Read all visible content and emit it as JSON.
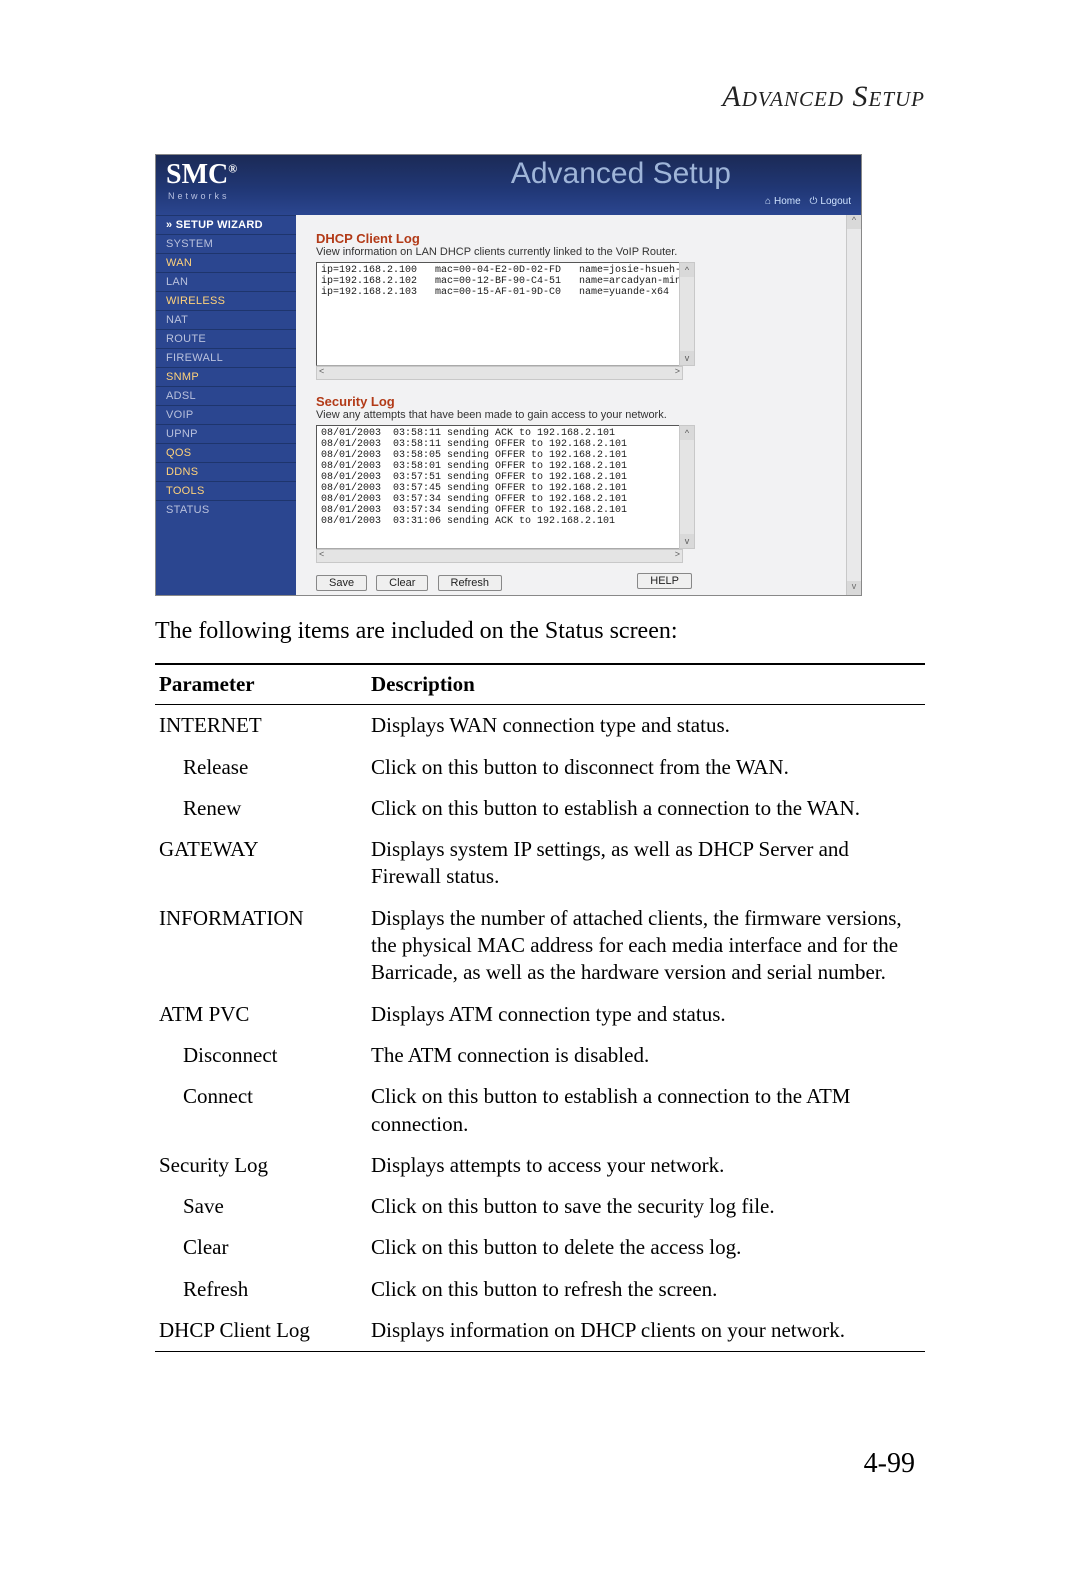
{
  "page": {
    "header": "Advanced Setup",
    "intro": "The following items are included on the Status screen:",
    "pagenum": "4-99"
  },
  "shot": {
    "brand": "SMC",
    "brand_sub": "Networks",
    "banner_title": "Advanced Setup",
    "home_label": "Home",
    "logout_label": "Logout",
    "sidebar": [
      "» SETUP WIZARD",
      "SYSTEM",
      "WAN",
      "LAN",
      "WIRELESS",
      "NAT",
      "ROUTE",
      "FIREWALL",
      "SNMP",
      "ADSL",
      "VoIP",
      "UPnP",
      "QoS",
      "DDNS",
      "TOOLS",
      "STATUS"
    ],
    "sidebar_accent_idx": [
      2,
      4,
      8,
      12,
      13,
      14
    ],
    "dhcp": {
      "heading": "DHCP Client Log",
      "sub": "View information on LAN DHCP clients currently linked to the VoIP Router.",
      "lines": "ip=192.168.2.100   mac=00-04-E2-0D-02-FD   name=josie-hsueh-pc\nip=192.168.2.102   mac=00-12-BF-90-C4-51   name=arcadyan-ming\nip=192.168.2.103   mac=00-15-AF-01-9D-C0   name=yuande-x64"
    },
    "seclog": {
      "heading": "Security Log",
      "sub": "View any attempts that have been made to gain access to your network.",
      "lines": "08/01/2003  03:58:11 sending ACK to 192.168.2.101\n08/01/2003  03:58:11 sending OFFER to 192.168.2.101\n08/01/2003  03:58:05 sending OFFER to 192.168.2.101\n08/01/2003  03:58:01 sending OFFER to 192.168.2.101\n08/01/2003  03:57:51 sending OFFER to 192.168.2.101\n08/01/2003  03:57:45 sending OFFER to 192.168.2.101\n08/01/2003  03:57:34 sending OFFER to 192.168.2.101\n08/01/2003  03:57:34 sending OFFER to 192.168.2.101\n08/01/2003  03:31:06 sending ACK to 192.168.2.101"
    },
    "buttons": {
      "save": "Save",
      "clear": "Clear",
      "refresh": "Refresh",
      "help": "HELP"
    }
  },
  "table": {
    "head_param": "Parameter",
    "head_desc": "Description",
    "rows": [
      {
        "p": "INTERNET",
        "d": "Displays WAN connection type and status.",
        "cls": "group"
      },
      {
        "p": "Release",
        "d": "Click on this button to disconnect from the WAN.",
        "cls": "sub"
      },
      {
        "p": "Renew",
        "d": "Click on this button to establish a connection to the WAN.",
        "cls": "sub"
      },
      {
        "p": "GATEWAY",
        "d": "Displays system IP settings, as well as DHCP Server and Firewall status.",
        "cls": "group"
      },
      {
        "p": "INFORMATION",
        "d": "Displays the number of attached clients, the firmware versions, the physical MAC address for each media interface and for the Barricade, as well as the hardware version and serial number.",
        "cls": "group"
      },
      {
        "p": "ATM PVC",
        "d": "Displays ATM connection type and status.",
        "cls": "group"
      },
      {
        "p": "Disconnect",
        "d": "The ATM connection is disabled.",
        "cls": "sub"
      },
      {
        "p": "Connect",
        "d": "Click on this button to establish a connection to the ATM connection.",
        "cls": "sub"
      },
      {
        "p": "Security Log",
        "d": "Displays attempts to access your network.",
        "cls": "group"
      },
      {
        "p": "Save",
        "d": "Click on this button to save the security log file.",
        "cls": "sub"
      },
      {
        "p": "Clear",
        "d": "Click on this button to delete the access log.",
        "cls": "sub"
      },
      {
        "p": "Refresh",
        "d": "Click on this button to refresh the screen.",
        "cls": "sub"
      },
      {
        "p": "DHCP Client Log",
        "d": "Displays information on DHCP clients on your network.",
        "cls": "group"
      }
    ]
  }
}
